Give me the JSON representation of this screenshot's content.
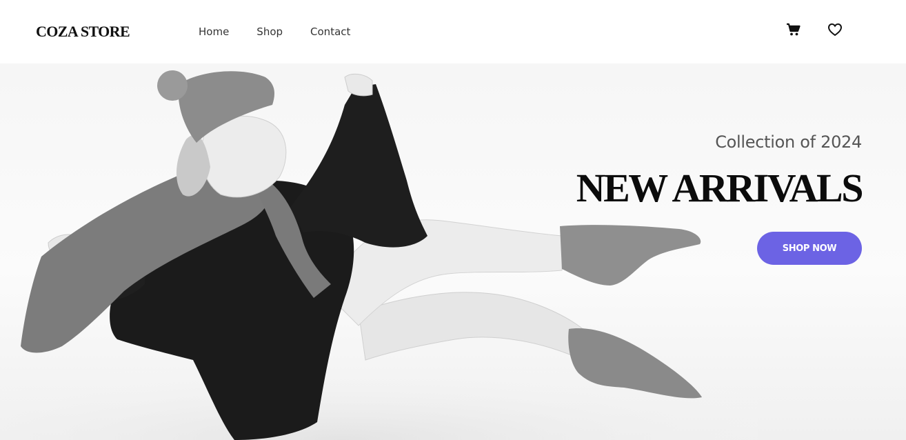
{
  "header": {
    "logo": "COZA STORE",
    "nav": [
      "Home",
      "Shop",
      "Contact"
    ],
    "icons": [
      "cart-icon",
      "heart-icon"
    ]
  },
  "hero": {
    "subtitle": "Collection of 2024",
    "title": "NEW ARRIVALS",
    "cta_label": "SHOP NOW",
    "image": "black-and-white photo of a woman in knit hat, scarf and socks sitting with legs raised"
  },
  "colors": {
    "accent": "#6c63e4",
    "text_dark": "#111111",
    "nav_text": "#333333"
  }
}
